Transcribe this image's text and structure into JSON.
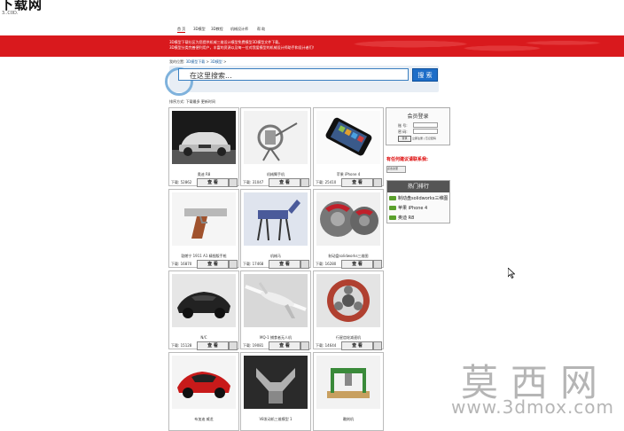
{
  "site": {
    "title": "下载网",
    "subtitle": "3..C0D."
  },
  "nav": {
    "items": [
      {
        "label": "首 页",
        "active": true
      },
      {
        "label": "3D模型",
        "active": false
      },
      {
        "label": "3D教程",
        "active": false
      },
      {
        "label": "机械设计师",
        "active": false
      },
      {
        "label": "帮 助",
        "active": false
      }
    ]
  },
  "banner": {
    "line1": "3D模型下载社区为您提供机械三维设计模型免费模型3D模型文件下载。",
    "line2": "3D模型分类完善便利用户，丰富的资源以及每一位对我爱模型的机械设计师助手和设计者们！",
    "bg_color": "#d9191d"
  },
  "breadcrumb": {
    "prefix": "我的位置:",
    "link1": "3D模型下载",
    "sep": ">",
    "link2": "3D模型",
    "tail": ">"
  },
  "search": {
    "placeholder": "在这里搜索...",
    "button": "搜 索"
  },
  "sort": {
    "label": "排序方式:",
    "option1": "下载最多",
    "option2": "更新时间"
  },
  "products": [
    {
      "name": "奥迪 R8",
      "downloads": "下载: 52862",
      "view": "查 看"
    },
    {
      "name": "机械臂手机",
      "downloads": "下载: 31047",
      "view": "查 看"
    },
    {
      "name": "苹果 iPhone 4",
      "downloads": "下载: 25410",
      "view": "查 看"
    },
    {
      "name": "勃朗宁 1911 A1 精细版手枪",
      "downloads": "下载: 16870",
      "view": "查 看"
    },
    {
      "name": "机械马",
      "downloads": "下载: 17468",
      "view": "查 看"
    },
    {
      "name": "制动盘solidworks三维图",
      "downloads": "下载: 16280",
      "view": "查 看"
    },
    {
      "name": "N/C",
      "downloads": "下载: 15128",
      "view": "查 看"
    },
    {
      "name": "MQ-1 捕食者无人机",
      "downloads": "下载: 19081",
      "view": "查 看"
    },
    {
      "name": "行星齿轮减速机",
      "downloads": "下载: 14644",
      "view": "查 看"
    },
    {
      "name": "布加迪 威龙",
      "downloads": "",
      "view": ""
    },
    {
      "name": "V8发动机三维模型 1",
      "downloads": "",
      "view": ""
    },
    {
      "name": "雕刻机",
      "downloads": "",
      "view": ""
    }
  ],
  "login": {
    "title": "会员登录",
    "user_label": "账 号:",
    "pass_label": "密 码:",
    "button": "登录",
    "register": "立即注册 | 忘记密码"
  },
  "promo": {
    "text": "有任何建议请联系我:",
    "chip": "点击这里"
  },
  "ranking": {
    "title": "热门排行",
    "items": [
      "制动盘solidworks三维图",
      "苹果 iPhone 4",
      "奥迪 R8"
    ]
  },
  "watermark": {
    "text": "莫西网",
    "url": "www.3dmox.com"
  },
  "icons": {
    "cursor": "mouse-pointer-icon",
    "rank_bullet": "arrow-right-icon",
    "search": "search-icon"
  }
}
